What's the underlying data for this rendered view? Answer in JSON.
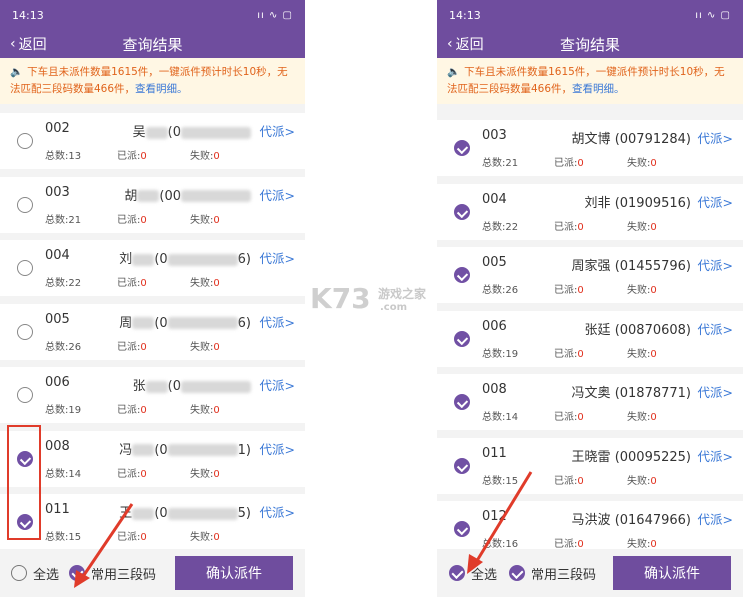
{
  "status_time": "14:13",
  "status_icons": "ıı ∿ ▢",
  "nav": {
    "back_label": "返回",
    "title": "查询结果"
  },
  "notice": {
    "text_left": "下车且未派件数量1615件，一键派件预计时长10秒，无法匹配三段码数量466件，",
    "text_right": "下车且未派件数量1615件，一键派件预计时长10秒，无法匹配三段码数量466件，",
    "link": "查看明细。"
  },
  "stats_labels": {
    "total": "总数:",
    "sent": "已派:",
    "failed": "失败:"
  },
  "left_rows": [
    {
      "code": "002",
      "name": "吴",
      "id_prefix": "(0",
      "id_suffix": "",
      "action": "代派>",
      "total": "13",
      "sent": "0",
      "failed": "0",
      "checked": false
    },
    {
      "code": "003",
      "name": "胡",
      "id_prefix": "(00",
      "id_suffix": "",
      "action": "代派>",
      "total": "21",
      "sent": "0",
      "failed": "0",
      "checked": false
    },
    {
      "code": "004",
      "name": "刘",
      "id_prefix": "(0",
      "id_suffix": "6)",
      "action": "代派>",
      "total": "22",
      "sent": "0",
      "failed": "0",
      "checked": false
    },
    {
      "code": "005",
      "name": "周",
      "id_prefix": "(0",
      "id_suffix": "6)",
      "action": "代派>",
      "total": "26",
      "sent": "0",
      "failed": "0",
      "checked": false
    },
    {
      "code": "006",
      "name": "张",
      "id_prefix": "(0",
      "id_suffix": "",
      "action": "代派>",
      "total": "19",
      "sent": "0",
      "failed": "0",
      "checked": false
    },
    {
      "code": "008",
      "name": "冯",
      "id_prefix": "(0",
      "id_suffix": "1)",
      "action": "代派>",
      "total": "14",
      "sent": "0",
      "failed": "0",
      "checked": true
    },
    {
      "code": "011",
      "name": "王",
      "id_prefix": "(0",
      "id_suffix": "5)",
      "action": "代派>",
      "total": "15",
      "sent": "0",
      "failed": "0",
      "checked": true
    }
  ],
  "right_rows": [
    {
      "code": "003",
      "name": "胡文博",
      "id": "(00791284)",
      "action": "代派>",
      "total": "21",
      "sent": "0",
      "failed": "0",
      "checked": true
    },
    {
      "code": "004",
      "name": "刘非",
      "id": "(01909516)",
      "action": "代派>",
      "total": "22",
      "sent": "0",
      "failed": "0",
      "checked": true
    },
    {
      "code": "005",
      "name": "周家强",
      "id": "(01455796)",
      "action": "代派>",
      "total": "26",
      "sent": "0",
      "failed": "0",
      "checked": true
    },
    {
      "code": "006",
      "name": "张廷",
      "id": "(00870608)",
      "action": "代派>",
      "total": "19",
      "sent": "0",
      "failed": "0",
      "checked": true
    },
    {
      "code": "008",
      "name": "冯文奥",
      "id": "(01878771)",
      "action": "代派>",
      "total": "14",
      "sent": "0",
      "failed": "0",
      "checked": true
    },
    {
      "code": "011",
      "name": "王晓雷",
      "id": "(00095225)",
      "action": "代派>",
      "total": "15",
      "sent": "0",
      "failed": "0",
      "checked": true
    },
    {
      "code": "012",
      "name": "马洪波",
      "id": "(01647966)",
      "action": "代派>",
      "total": "16",
      "sent": "0",
      "failed": "0",
      "checked": true
    }
  ],
  "bottom": {
    "select_all": "全选",
    "common_code": "常用三段码",
    "confirm": "确认派件"
  },
  "watermark": {
    "big": "K73",
    "line1": "游戏之家",
    "line2": ".com"
  },
  "colors": {
    "primary": "#6f4d9e",
    "link": "#3a78d6",
    "warn": "#e0631b",
    "highlight": "#e03b2a"
  }
}
